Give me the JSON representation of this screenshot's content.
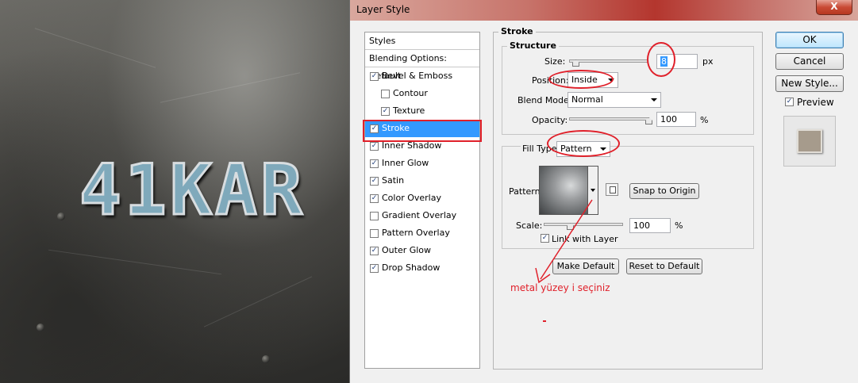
{
  "canvas": {
    "artwork_text": "41KAR"
  },
  "window": {
    "title": "Layer Style",
    "close_label": "X"
  },
  "styles_list": {
    "header": "Styles",
    "blending_options": "Blending Options: Default",
    "items": [
      {
        "label": "Bevel & Emboss",
        "checked": true,
        "level": 0
      },
      {
        "label": "Contour",
        "checked": false,
        "level": 1
      },
      {
        "label": "Texture",
        "checked": true,
        "level": 1
      },
      {
        "label": "Stroke",
        "checked": true,
        "level": 0,
        "selected": true
      },
      {
        "label": "Inner Shadow",
        "checked": true,
        "level": 0
      },
      {
        "label": "Inner Glow",
        "checked": true,
        "level": 0
      },
      {
        "label": "Satin",
        "checked": true,
        "level": 0
      },
      {
        "label": "Color Overlay",
        "checked": true,
        "level": 0
      },
      {
        "label": "Gradient Overlay",
        "checked": false,
        "level": 0
      },
      {
        "label": "Pattern Overlay",
        "checked": false,
        "level": 0
      },
      {
        "label": "Outer Glow",
        "checked": true,
        "level": 0
      },
      {
        "label": "Drop Shadow",
        "checked": true,
        "level": 0
      }
    ]
  },
  "stroke": {
    "title": "Stroke",
    "structure": {
      "legend": "Structure",
      "size_label": "Size:",
      "size_value": "8",
      "size_unit": "px",
      "size_slider_fraction": 0.08,
      "position_label": "Position:",
      "position_value": "Inside",
      "blend_mode_label": "Blend Mode:",
      "blend_mode_value": "Normal",
      "opacity_label": "Opacity:",
      "opacity_value": "100",
      "opacity_unit": "%",
      "opacity_slider_fraction": 1.0
    },
    "fill": {
      "fill_type_label": "Fill Type:",
      "fill_type_value": "Pattern",
      "pattern_label": "Pattern:",
      "snap_button": "Snap to Origin",
      "scale_label": "Scale:",
      "scale_value": "100",
      "scale_unit": "%",
      "scale_slider_fraction": 0.33,
      "link_label": "Link with Layer",
      "link_checked": true
    },
    "make_default": "Make Default",
    "reset_default": "Reset to Default"
  },
  "right": {
    "ok": "OK",
    "cancel": "Cancel",
    "new_style": "New Style...",
    "preview_label": "Preview",
    "preview_checked": true
  },
  "annotation": {
    "text": "metal yüzey i seçiniz",
    "color": "#e0202a"
  },
  "colors": {
    "selection": "#3399ff",
    "annotation_red": "#e0202a",
    "titlebar_red": "#b4362e"
  }
}
